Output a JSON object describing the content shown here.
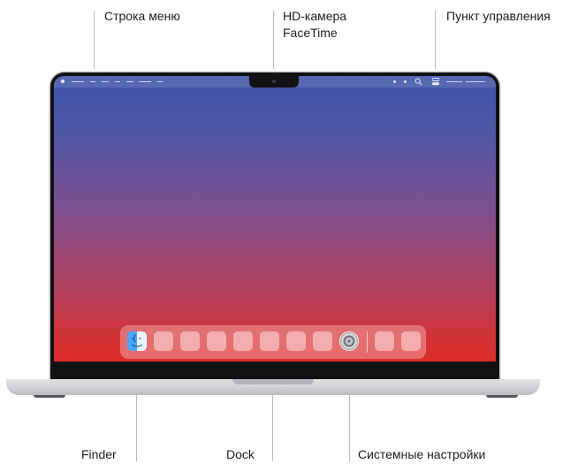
{
  "callouts": {
    "menu_bar": "Строка меню",
    "camera_line1": "HD-камера",
    "camera_line2": "FaceTime",
    "control_center": "Пункт управления",
    "finder": "Finder",
    "dock": "Dock",
    "system_settings": "Системные настройки"
  },
  "colors": {
    "wallpaper_top": "#3d53a9",
    "wallpaper_bottom": "#dc2d2d",
    "bezel": "#111113",
    "leader_line": "#b9b9bd"
  },
  "icons": {
    "finder": "finder-icon",
    "system_settings": "gear-icon",
    "camera": "camera-icon",
    "control_center": "control-center-icon",
    "search": "search-icon"
  },
  "dock": {
    "placeholder_apps_before_settings": 7,
    "placeholder_apps_after_separator": 2
  }
}
